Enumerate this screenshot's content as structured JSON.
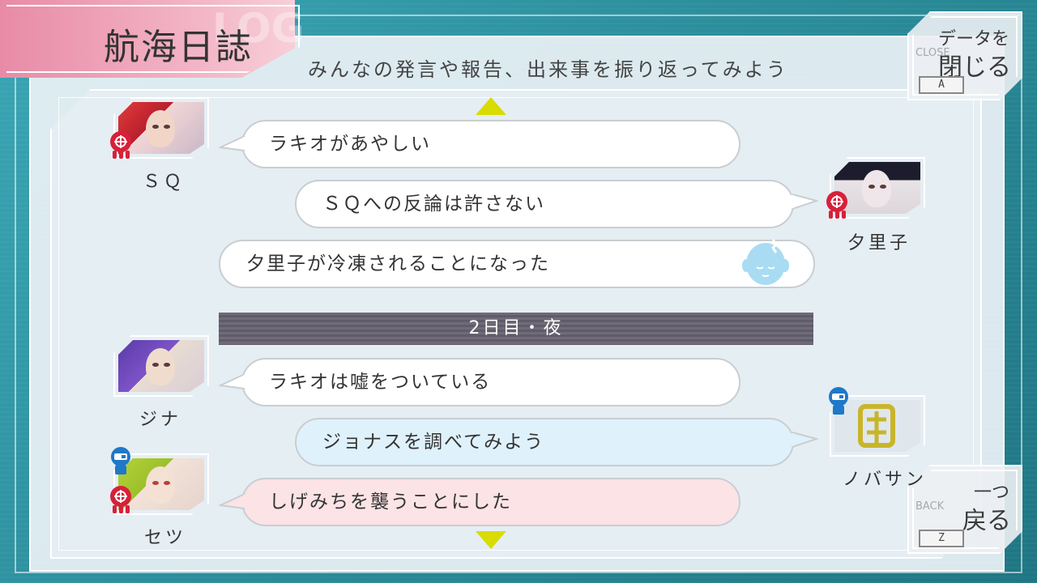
{
  "header": {
    "title": "航海日誌",
    "title_ghost": "LOG",
    "subtitle": "みんなの発言や報告、出来事を振り返ってみよう"
  },
  "close_button": {
    "line1": "データを",
    "line2": "閉じる",
    "ghost": "CLOSE",
    "key": "A"
  },
  "back_button": {
    "line1": "一つ",
    "line2": "戻る",
    "ghost": "BACK",
    "key": "Z"
  },
  "day_separator": "2日目・夜",
  "log_entries": [
    {
      "speaker": "ＳＱ",
      "text": "ラキオがあやしい",
      "side": "left",
      "style": "white",
      "badges": [
        "red"
      ]
    },
    {
      "speaker": "夕里子",
      "text": "ＳＱへの反論は許さない",
      "side": "right",
      "style": "white",
      "badges": [
        "red"
      ]
    },
    {
      "speaker": "",
      "text": "夕里子が冷凍されることになった",
      "side": "none",
      "style": "white",
      "badges": []
    },
    {
      "speaker": "ジナ",
      "text": "ラキオは嘘をついている",
      "side": "left",
      "style": "white",
      "badges": []
    },
    {
      "speaker": "ノバサン",
      "text": "ジョナスを調べてみよう",
      "side": "right",
      "style": "blue",
      "badges": [
        "blue"
      ]
    },
    {
      "speaker": "セツ",
      "text": "しげみちを襲うことにした",
      "side": "left",
      "style": "pink",
      "badges": [
        "blue",
        "red"
      ]
    }
  ],
  "colors": {
    "accent_arrow": "#d8dc00",
    "title_tab": "#e88ba6",
    "gnosia_badge": "#d8203a",
    "engineer_badge": "#1f78c8",
    "background": "#2c8e9c"
  },
  "icons": {
    "scroll_up": "triangle-up-icon",
    "scroll_down": "triangle-down-icon",
    "frozen": "frozen-head-icon",
    "gnosia": "gnosia-badge-icon",
    "engineer": "engineer-badge-icon"
  }
}
